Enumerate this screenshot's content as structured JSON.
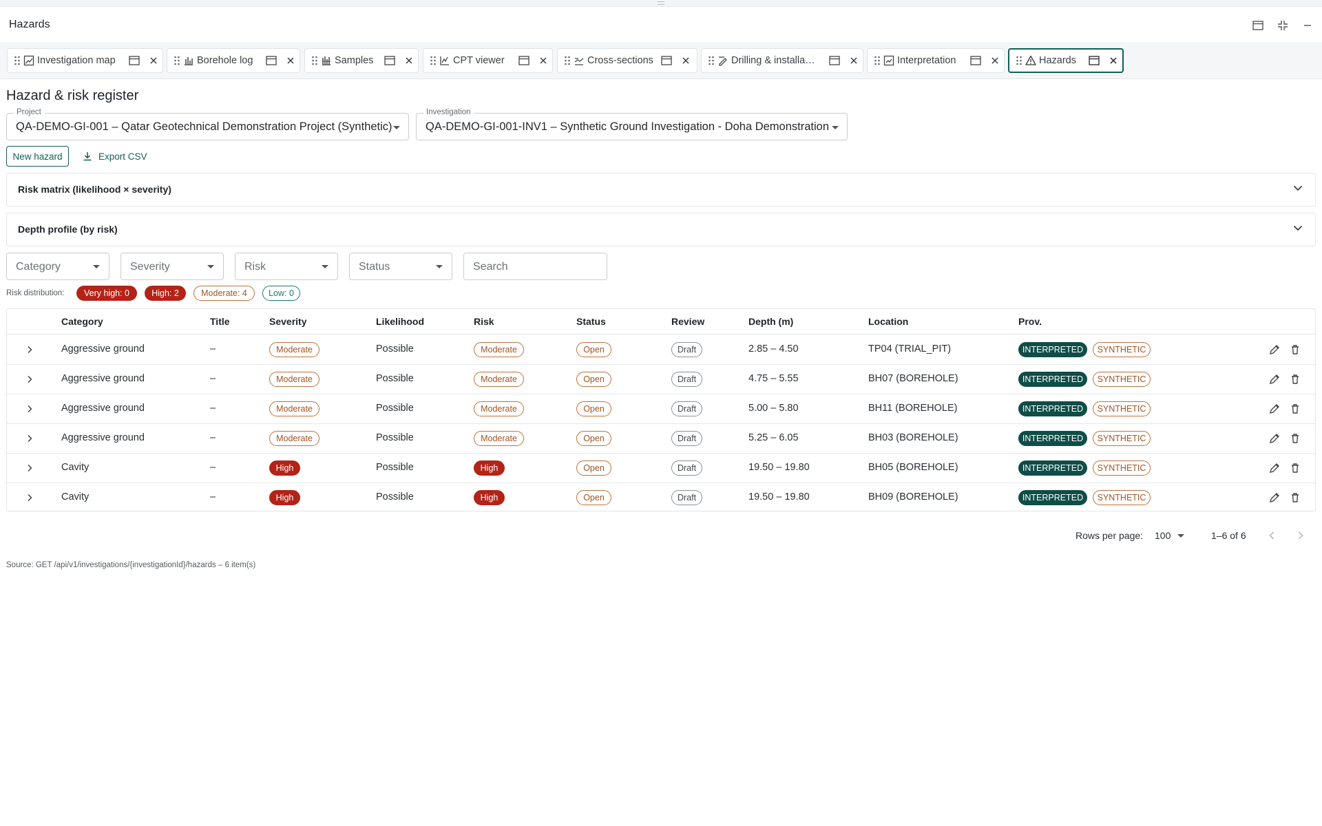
{
  "window": {
    "title": "Hazards"
  },
  "tabs": [
    {
      "label": "Investigation map",
      "icon": "map-icon"
    },
    {
      "label": "Borehole log",
      "icon": "chart-icon"
    },
    {
      "label": "Samples",
      "icon": "samples-icon"
    },
    {
      "label": "CPT viewer",
      "icon": "line-chart-icon"
    },
    {
      "label": "Cross-sections",
      "icon": "cross-section-icon"
    },
    {
      "label": "Drilling & installa…",
      "icon": "drilling-icon"
    },
    {
      "label": "Interpretation",
      "icon": "interpretation-icon"
    },
    {
      "label": "Hazards",
      "icon": "warning-icon",
      "active": true
    }
  ],
  "page": {
    "title": "Hazard & risk register",
    "project": {
      "label": "Project",
      "value": "QA-DEMO-GI-001 – Qatar Geotechnical Demonstration Project (Synthetic)"
    },
    "investigation": {
      "label": "Investigation",
      "value": "QA-DEMO-GI-001-INV1 – Synthetic Ground Investigation - Doha Demonstration"
    },
    "new_hazard": "New hazard",
    "export_csv": "Export CSV",
    "accordion_matrix": "Risk matrix (likelihood × severity)",
    "accordion_depth": "Depth profile (by risk)"
  },
  "filters": {
    "category": "Category",
    "severity": "Severity",
    "risk": "Risk",
    "status": "Status",
    "search": "Search"
  },
  "risk_distribution": {
    "label": "Risk distribution:",
    "very_high": "Very high: 0",
    "high": "High: 2",
    "moderate": "Moderate: 4",
    "low": "Low: 0"
  },
  "table": {
    "headers": {
      "category": "Category",
      "title": "Title",
      "severity": "Severity",
      "likelihood": "Likelihood",
      "risk": "Risk",
      "status": "Status",
      "review": "Review",
      "depth": "Depth (m)",
      "location": "Location",
      "prov": "Prov."
    },
    "rows": [
      {
        "category": "Aggressive ground",
        "title": "–",
        "severity": "Moderate",
        "likelihood": "Possible",
        "risk": "Moderate",
        "status": "Open",
        "review": "Draft",
        "depth": "2.85 – 4.50",
        "location": "TP04 (TRIAL_PIT)",
        "prov1": "INTERPRETED",
        "prov2": "SYNTHETIC"
      },
      {
        "category": "Aggressive ground",
        "title": "–",
        "severity": "Moderate",
        "likelihood": "Possible",
        "risk": "Moderate",
        "status": "Open",
        "review": "Draft",
        "depth": "4.75 – 5.55",
        "location": "BH07 (BOREHOLE)",
        "prov1": "INTERPRETED",
        "prov2": "SYNTHETIC"
      },
      {
        "category": "Aggressive ground",
        "title": "–",
        "severity": "Moderate",
        "likelihood": "Possible",
        "risk": "Moderate",
        "status": "Open",
        "review": "Draft",
        "depth": "5.00 – 5.80",
        "location": "BH11 (BOREHOLE)",
        "prov1": "INTERPRETED",
        "prov2": "SYNTHETIC"
      },
      {
        "category": "Aggressive ground",
        "title": "–",
        "severity": "Moderate",
        "likelihood": "Possible",
        "risk": "Moderate",
        "status": "Open",
        "review": "Draft",
        "depth": "5.25 – 6.05",
        "location": "BH03 (BOREHOLE)",
        "prov1": "INTERPRETED",
        "prov2": "SYNTHETIC"
      },
      {
        "category": "Cavity",
        "title": "–",
        "severity": "High",
        "likelihood": "Possible",
        "risk": "High",
        "status": "Open",
        "review": "Draft",
        "depth": "19.50 – 19.80",
        "location": "BH05 (BOREHOLE)",
        "prov1": "INTERPRETED",
        "prov2": "SYNTHETIC"
      },
      {
        "category": "Cavity",
        "title": "–",
        "severity": "High",
        "likelihood": "Possible",
        "risk": "High",
        "status": "Open",
        "review": "Draft",
        "depth": "19.50 – 19.80",
        "location": "BH09 (BOREHOLE)",
        "prov1": "INTERPRETED",
        "prov2": "SYNTHETIC"
      }
    ]
  },
  "pagination": {
    "rows_per_page_label": "Rows per page:",
    "rows_per_page": "100",
    "range": "1–6 of 6"
  },
  "footer": {
    "source": "Source: GET /api/v1/investigations/{investigationId}/hazards – 6 item(s)"
  },
  "colors": {
    "accent": "#0f5f57",
    "high": "#b42318",
    "moderate": "#c0703a",
    "low": "#1a7a6e"
  }
}
